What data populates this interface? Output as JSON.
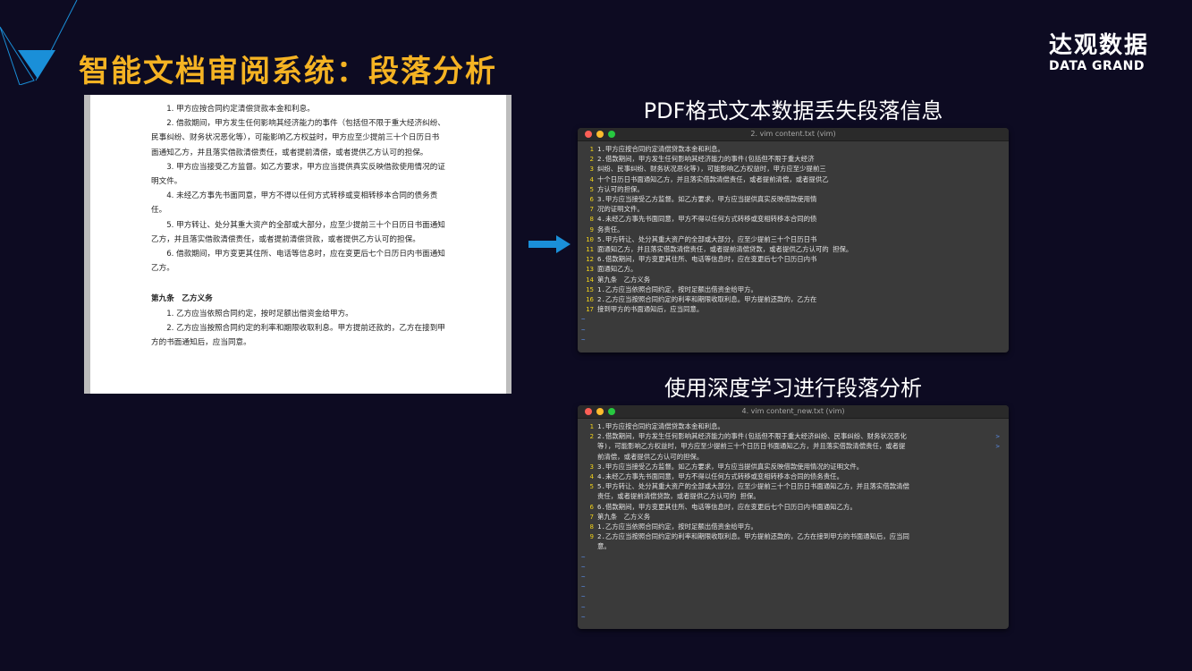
{
  "slide_title": "智能文档审阅系统：段落分析",
  "logo": {
    "cn": "达观数据",
    "en": "DATA GRAND"
  },
  "colors": {
    "title": "#f5b323",
    "background": "#0d0b22",
    "accent": "#1a8fd8",
    "line_number": "#f2d21a",
    "tilde": "#5b8de8"
  },
  "icons": {
    "arrow": "arrow-right-icon",
    "decoration": "triangle-logo-icon"
  },
  "document": {
    "paragraphs": [
      "1. 甲方应按合同约定清偿贷款本金和利息。",
      "2. 借款期间，甲方发生任何影响其经济能力的事件（包括但不限于重大经济纠纷、民事纠纷、财务状况恶化等），可能影响乙方权益时，甲方应至少提前三十个日历日书面通知乙方，并且落实借款清偿责任，或者提前清偿，或者提供乙方认可的担保。",
      "3. 甲方应当接受乙方监督。如乙方要求，甲方应当提供真实反映借款使用情况的证明文件。",
      "4. 未经乙方事先书面同意，甲方不得以任何方式转移或变相转移本合同的债务责任。",
      "5. 甲方转让、处分其重大资产的全部或大部分，应至少提前三十个日历日书面通知乙方，并且落实借款清偿责任，或者提前清偿贷款，或者提供乙方认可的担保。",
      "6. 借款期间，甲方变更其住所、电话等信息时，应在变更后七个日历日内书面通知乙方。"
    ],
    "section_heading": "第九条　乙方义务",
    "section_paragraphs": [
      "1. 乙方应当依照合同约定，按时足额出借资金给甲方。",
      "2. 乙方应当按照合同约定的利率和期限收取利息。甲方提前还款的，乙方在接到甲方的书面通知后，应当同意。"
    ]
  },
  "section1": {
    "heading": "PDF格式文本数据丢失段落信息",
    "terminal_title": "2. vim content.txt (vim)",
    "lines": [
      {
        "n": "1",
        "t": "1.甲方应按合同约定清偿贷款本金和利息。"
      },
      {
        "n": "2",
        "t": "2.借款期间，甲方发生任何影响其经济能力的事件(包括但不限于重大经济"
      },
      {
        "n": "3",
        "t": "纠纷、民事纠纷、财务状况恶化等)，可能影响乙方权益时，甲方应至少提前三"
      },
      {
        "n": "4",
        "t": "十个日历日书面通知乙方，并且落实借款清偿责任，或者提前清偿，或者提供乙"
      },
      {
        "n": "5",
        "t": "方认可的担保。"
      },
      {
        "n": "6",
        "t": "3.甲方应当接受乙方监督。如乙方要求，甲方应当提供真实反映借款使用情"
      },
      {
        "n": "7",
        "t": "况的证明文件。"
      },
      {
        "n": "8",
        "t": "4.未经乙方事先书面同意，甲方不得以任何方式转移或变相转移本合同的债"
      },
      {
        "n": "9",
        "t": "务责任。"
      },
      {
        "n": "10",
        "t": "5.甲方转让、处分其重大资产的全部或大部分，应至少提前三十个日历日书"
      },
      {
        "n": "11",
        "t": "面通知乙方，并且落实借款清偿责任，或者提前清偿贷款，或者提供乙方认可的 担保。"
      },
      {
        "n": "12",
        "t": "6.借款期间，甲方变更其住所、电话等信息时，应在变更后七个日历日内书"
      },
      {
        "n": "13",
        "t": "面通知乙方。"
      },
      {
        "n": "14",
        "t": "第九条　乙方义务"
      },
      {
        "n": "15",
        "t": "1.乙方应当依照合同约定，按时足额出借资金给甲方。"
      },
      {
        "n": "16",
        "t": "2.乙方应当按照合同约定的利率和期限收取利息。甲方提前还款的，乙方在"
      },
      {
        "n": "17",
        "t": "接到甲方的书面通知后，应当同意。"
      }
    ],
    "tildes": [
      "~",
      "~",
      "~"
    ]
  },
  "section2": {
    "heading": "使用深度学习进行段落分析",
    "terminal_title": "4. vim content_new.txt (vim)",
    "lines": [
      {
        "n": "1",
        "t": "1.甲方应按合同约定清偿贷款本金和利息。"
      },
      {
        "n": "2",
        "t": "2.借款期间，甲方发生任何影响其经济能力的事件(包括但不限于重大经济纠纷、民事纠纷、财务状况恶化",
        "c": ">"
      },
      {
        "n": "",
        "t": "等)，可能影响乙方权益时，甲方应至少提前三十个日历日书面通知乙方，并且落实借款清偿责任，或者提",
        "c": ">"
      },
      {
        "n": "",
        "t": "前清偿，或者提供乙方认可的担保。"
      },
      {
        "n": "3",
        "t": "3.甲方应当接受乙方监督。如乙方要求，甲方应当提供真实反映借款使用情况的证明文件。"
      },
      {
        "n": "4",
        "t": "4.未经乙方事先书面同意，甲方不得以任何方式转移或变相转移本合同的债务责任。"
      },
      {
        "n": "5",
        "t": "5.甲方转让、处分其重大资产的全部或大部分，应至少提前三十个日历日书面通知乙方，并且落实借款清偿"
      },
      {
        "n": "",
        "t": "责任，或者提前清偿贷款，或者提供乙方认可的 担保。"
      },
      {
        "n": "6",
        "t": "6.借款期间，甲方变更其住所、电话等信息时，应在变更后七个日历日内书面通知乙方。"
      },
      {
        "n": "7",
        "t": "第九条　乙方义务"
      },
      {
        "n": "8",
        "t": "1.乙方应当依照合同约定，按时足额出借资金给甲方。"
      },
      {
        "n": "9",
        "t": "2.乙方应当按照合同约定的利率和期限收取利息。甲方提前还款的，乙方在接到甲方的书面通知后，应当同"
      },
      {
        "n": "",
        "t": "意。"
      }
    ],
    "tildes": [
      "~",
      "~",
      "~",
      "~",
      "~",
      "~",
      "~"
    ]
  }
}
